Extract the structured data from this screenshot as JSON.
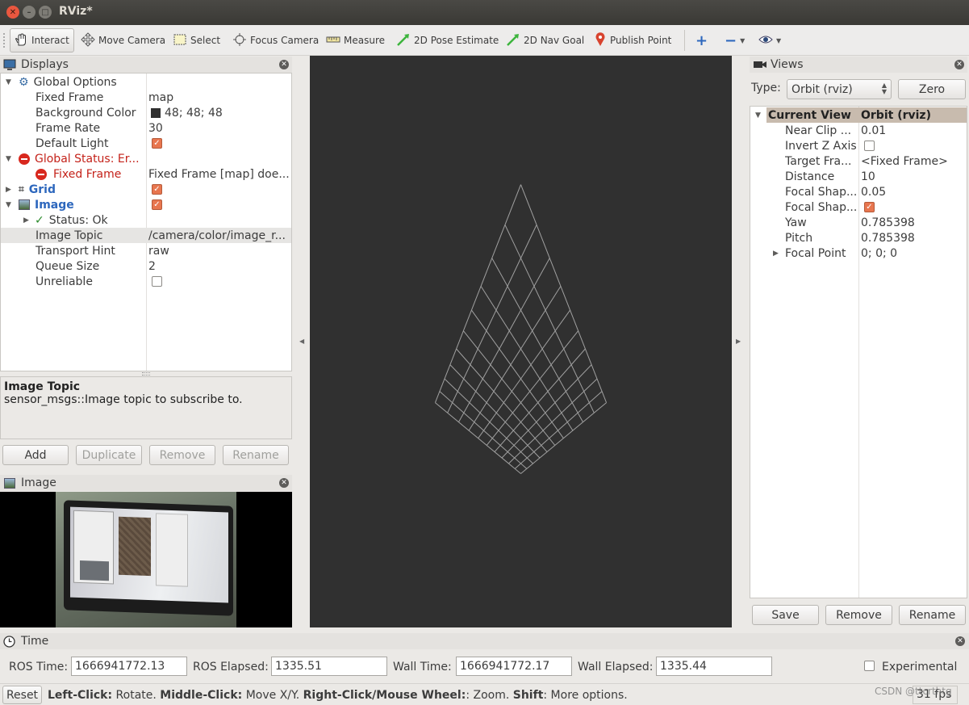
{
  "window": {
    "title": "RViz*"
  },
  "toolbar": {
    "tools": [
      {
        "label": "Interact",
        "icon": "hand-icon"
      },
      {
        "label": "Move Camera",
        "icon": "move-camera-icon"
      },
      {
        "label": "Select",
        "icon": "select-icon"
      },
      {
        "label": "Focus Camera",
        "icon": "focus-camera-icon"
      },
      {
        "label": "Measure",
        "icon": "ruler-icon"
      },
      {
        "label": "2D Pose Estimate",
        "icon": "pose-arrow-icon"
      },
      {
        "label": "2D Nav Goal",
        "icon": "nav-goal-arrow-icon"
      },
      {
        "label": "Publish Point",
        "icon": "map-pin-icon"
      }
    ]
  },
  "displays": {
    "title": "Displays",
    "global_options": {
      "label": "Global Options",
      "fixed_frame": {
        "name": "Fixed Frame",
        "value": "map"
      },
      "background_color": {
        "name": "Background Color",
        "value": "48; 48; 48",
        "swatch": "#303030"
      },
      "frame_rate": {
        "name": "Frame Rate",
        "value": "30"
      },
      "default_light": {
        "name": "Default Light",
        "checked": true
      }
    },
    "global_status": {
      "label": "Global Status: Er...",
      "fixed_frame": {
        "name": "Fixed Frame",
        "value": "Fixed Frame [map] doe..."
      }
    },
    "grid": {
      "label": "Grid",
      "checked": true
    },
    "image": {
      "label": "Image",
      "checked": true,
      "status": "Status: Ok",
      "image_topic": {
        "name": "Image Topic",
        "value": "/camera/color/image_r..."
      },
      "transport_hint": {
        "name": "Transport Hint",
        "value": "raw"
      },
      "queue_size": {
        "name": "Queue Size",
        "value": "2"
      },
      "unreliable": {
        "name": "Unreliable",
        "checked": false
      }
    },
    "help": {
      "title": "Image Topic",
      "text": "sensor_msgs::Image topic to subscribe to."
    },
    "buttons": {
      "add": "Add",
      "duplicate": "Duplicate",
      "remove": "Remove",
      "rename": "Rename"
    }
  },
  "image_panel": {
    "title": "Image"
  },
  "views": {
    "title": "Views",
    "type_label": "Type:",
    "type_value": "Orbit (rviz)",
    "zero": "Zero",
    "header": {
      "name": "Current View",
      "value": "Orbit (rviz)"
    },
    "props": [
      {
        "name": "Near Clip ...",
        "value": "0.01"
      },
      {
        "name": "Invert Z Axis",
        "value": ""
      },
      {
        "name": "Target Fra...",
        "value": "<Fixed Frame>"
      },
      {
        "name": "Distance",
        "value": "10"
      },
      {
        "name": "Focal Shap...",
        "value": "0.05"
      },
      {
        "name": "Focal Shap...",
        "value": ""
      },
      {
        "name": "Yaw",
        "value": "0.785398"
      },
      {
        "name": "Pitch",
        "value": "0.785398"
      },
      {
        "name": "Focal Point",
        "value": "0; 0; 0"
      }
    ],
    "invert_z_checked": false,
    "focal_shape_fixed_checked": true,
    "buttons": {
      "save": "Save",
      "remove": "Remove",
      "rename": "Rename"
    }
  },
  "time": {
    "title": "Time",
    "ros_time_label": "ROS Time:",
    "ros_time": "1666941772.13",
    "ros_elapsed_label": "ROS Elapsed:",
    "ros_elapsed": "1335.51",
    "wall_time_label": "Wall Time:",
    "wall_time": "1666941772.17",
    "wall_elapsed_label": "Wall Elapsed:",
    "wall_elapsed": "1335.44",
    "experimental": "Experimental",
    "experimental_checked": false
  },
  "status_bar": {
    "reset": "Reset",
    "left_click": "Left-Click:",
    "left_click_desc": " Rotate. ",
    "middle_click": "Middle-Click:",
    "middle_click_desc": " Move X/Y. ",
    "right_click": "Right-Click/Mouse Wheel:",
    "right_click_desc": ": Zoom. ",
    "shift": "Shift",
    "shift_desc": ": More options.",
    "fps": "31 fps",
    "watermark": "CSDN @ttcrthtg"
  }
}
